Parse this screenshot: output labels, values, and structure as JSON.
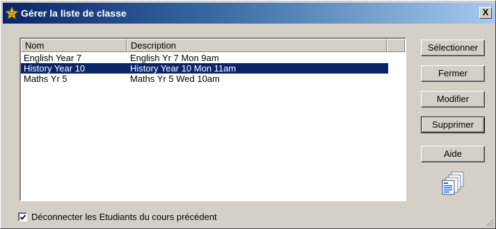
{
  "window": {
    "title": "Gérer la liste de classe",
    "close_label": "X",
    "title_icon": "star-icon"
  },
  "listview": {
    "columns": [
      "Nom",
      "Description"
    ],
    "rows": [
      {
        "name": "English Year 7",
        "description": "English Yr 7 Mon 9am",
        "selected": false
      },
      {
        "name": "History Year 10",
        "description": "History Year 10 Mon 11am",
        "selected": true
      },
      {
        "name": "Maths Yr 5",
        "description": "Maths Yr 5 Wed 10am",
        "selected": false
      }
    ]
  },
  "buttons": {
    "select": "Sélectionner",
    "close": "Fermer",
    "modify": "Modifier",
    "delete": "Supprimer",
    "help": "Aide"
  },
  "icons": {
    "documents": "documents-icon",
    "resize_grip": "resize-grip-icon"
  },
  "checkbox": {
    "label": "Déconnecter les Etudiants du cours précédent",
    "checked": true
  },
  "colors": {
    "title_start": "#0a246a",
    "title_end": "#a6caf0",
    "selection": "#0a246a",
    "face": "#d4d0c8"
  }
}
